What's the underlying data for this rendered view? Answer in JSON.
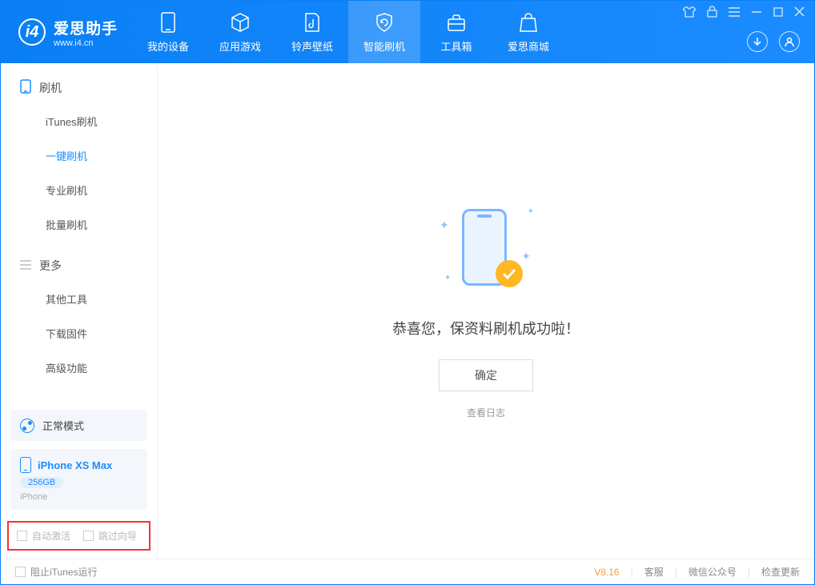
{
  "app": {
    "title": "爱思助手",
    "subtitle": "www.i4.cn"
  },
  "nav": {
    "my_device": "我的设备",
    "apps_games": "应用游戏",
    "ringtone_wallpaper": "铃声壁纸",
    "smart_flash": "智能刷机",
    "toolbox": "工具箱",
    "store": "爱思商城"
  },
  "sidebar": {
    "group_flash": "刷机",
    "items_flash": {
      "itunes_flash": "iTunes刷机",
      "one_click_flash": "一键刷机",
      "pro_flash": "专业刷机",
      "batch_flash": "批量刷机"
    },
    "group_more": "更多",
    "items_more": {
      "other_tools": "其他工具",
      "download_firmware": "下载固件",
      "advanced": "高级功能"
    }
  },
  "device_panel": {
    "mode": "正常模式",
    "name": "iPhone XS Max",
    "storage": "256GB",
    "type": "iPhone"
  },
  "options": {
    "auto_activate": "自动激活",
    "skip_guide": "跳过向导"
  },
  "main": {
    "success_message": "恭喜您，保资料刷机成功啦！",
    "ok_button": "确定",
    "view_log": "查看日志"
  },
  "statusbar": {
    "block_itunes": "阻止iTunes运行",
    "version": "V8.16",
    "support": "客服",
    "wechat": "微信公众号",
    "check_update": "检查更新"
  }
}
